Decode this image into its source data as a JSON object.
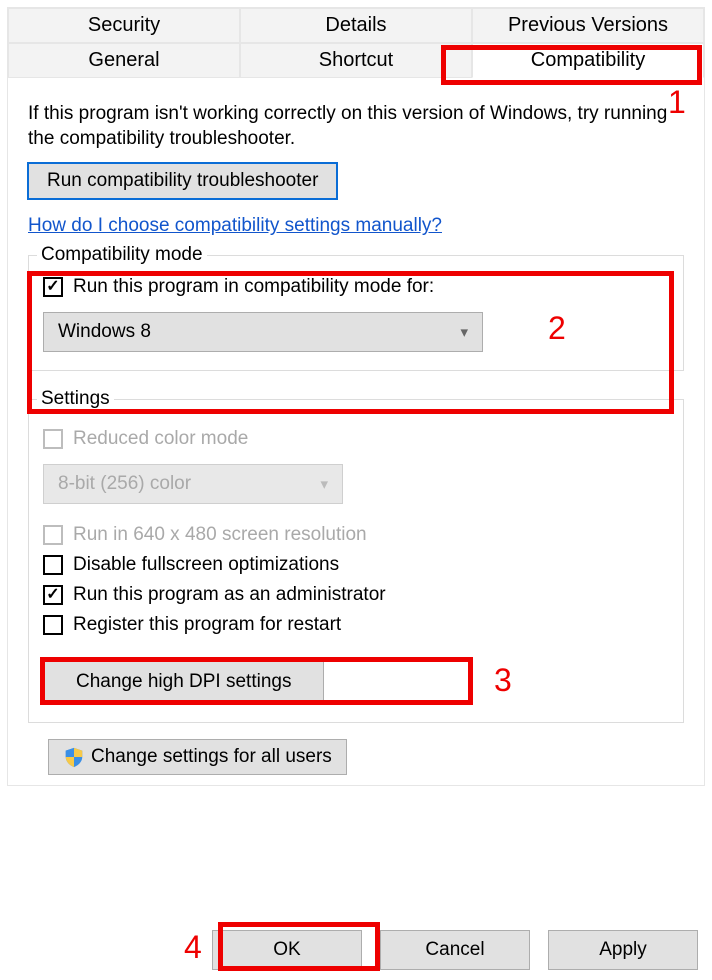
{
  "tabs": {
    "row1": [
      "Security",
      "Details",
      "Previous Versions"
    ],
    "row2": [
      "General",
      "Shortcut",
      "Compatibility"
    ],
    "active": "Compatibility"
  },
  "intro": "If this program isn't working correctly on this version of Windows, try running the compatibility troubleshooter.",
  "troubleshoot_btn": "Run compatibility troubleshooter",
  "help_link": "How do I choose compatibility settings manually?",
  "compat_mode": {
    "legend": "Compatibility mode",
    "checkbox_label": "Run this program in compatibility mode for:",
    "checked": true,
    "combo_value": "Windows 8"
  },
  "settings": {
    "legend": "Settings",
    "reduced_color": {
      "label": "Reduced color mode",
      "checked": false,
      "disabled": true
    },
    "color_combo": {
      "value": "8-bit (256) color",
      "disabled": true
    },
    "low_res": {
      "label": "Run in 640 x 480 screen resolution",
      "checked": false,
      "disabled": true
    },
    "disable_fullscreen": {
      "label": "Disable fullscreen optimizations",
      "checked": false,
      "disabled": false
    },
    "run_admin": {
      "label": "Run this program as an administrator",
      "checked": true,
      "disabled": false
    },
    "register_restart": {
      "label": "Register this program for restart",
      "checked": false,
      "disabled": false
    },
    "dpi_btn": "Change high DPI settings"
  },
  "all_users_btn": "Change settings for all users",
  "buttons": {
    "ok": "OK",
    "cancel": "Cancel",
    "apply": "Apply"
  },
  "annotations": {
    "n1": "1",
    "n2": "2",
    "n3": "3",
    "n4": "4"
  }
}
